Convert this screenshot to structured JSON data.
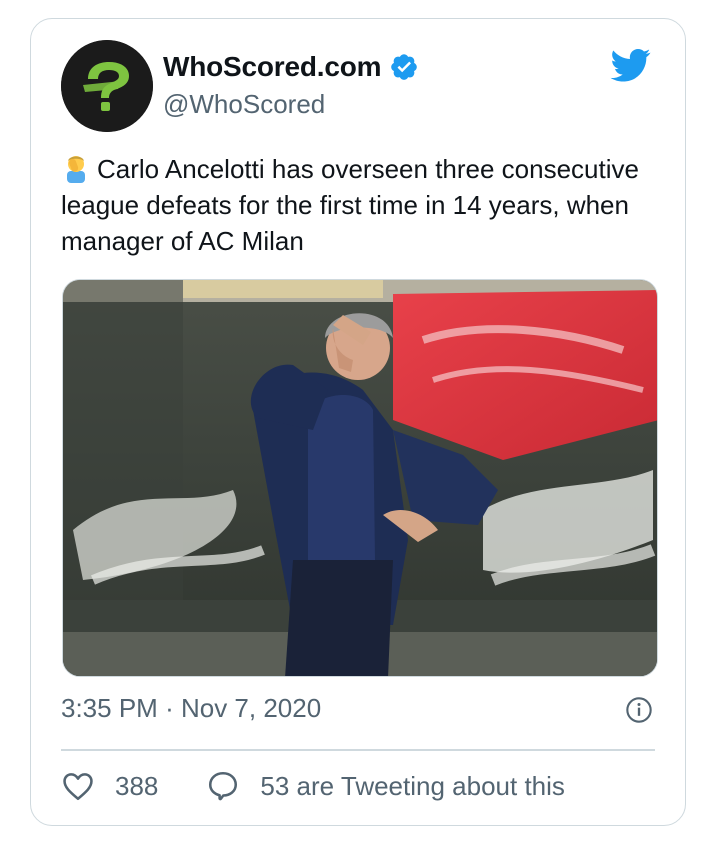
{
  "account": {
    "name": "WhoScored.com",
    "handle": "@WhoScored",
    "verified": true
  },
  "tweet": {
    "text": "Carlo Ancelotti has overseen three consecutive league defeats for the first time in 14 years, when manager of AC Milan",
    "emoji": "facepalm-emoji"
  },
  "meta": {
    "time": "3:35 PM",
    "separator": "·",
    "date": "Nov 7, 2020"
  },
  "actions": {
    "likes": "388",
    "tweeting": "53 are Tweeting about this"
  },
  "colors": {
    "brand_blue": "#1d9bf0",
    "muted": "#536471",
    "border": "#cfd9de",
    "logo_green": "#7ec440"
  }
}
